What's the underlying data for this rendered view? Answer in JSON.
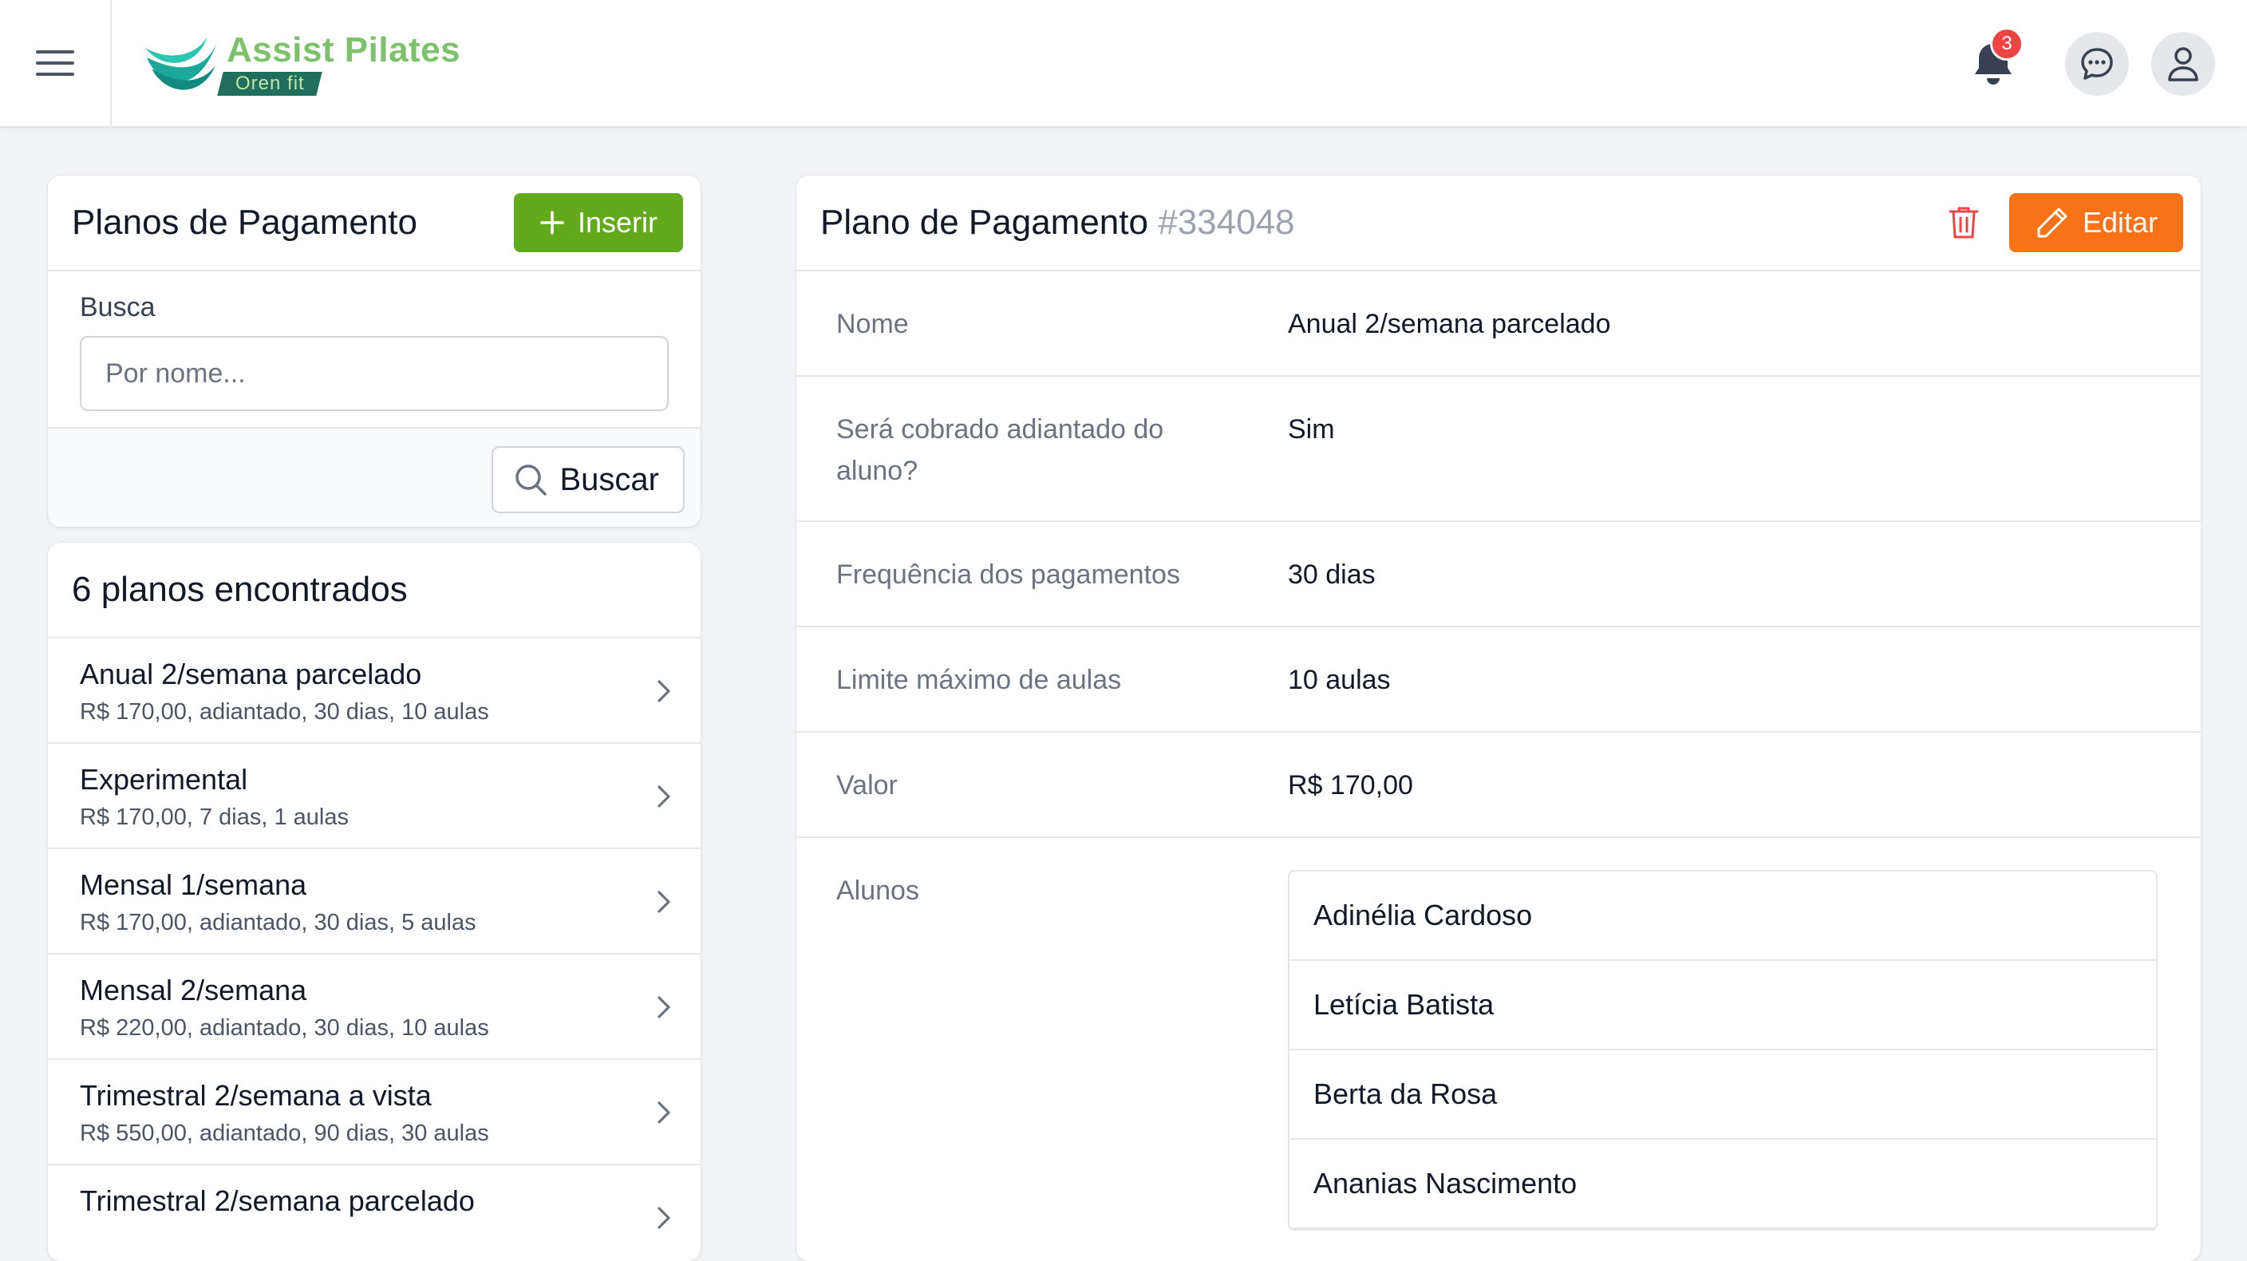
{
  "app": {
    "logo_title": "Assist Pilates",
    "logo_subtitle": "Oren fit",
    "notifications_count": "3"
  },
  "colors": {
    "primary_green": "#62a91c",
    "accent_orange": "#f97316",
    "danger_red": "#ef4444",
    "logo_green": "#7cc26a",
    "logo_dark": "#1f6f5c"
  },
  "icons": [
    "menu-icon",
    "bell-icon",
    "chat-icon",
    "user-icon",
    "plus-icon",
    "search-icon",
    "chevron-right-icon",
    "trash-icon",
    "pencil-icon"
  ],
  "plans_panel": {
    "title": "Planos de Pagamento",
    "insert_label": "Inserir",
    "search_label": "Busca",
    "search_placeholder": "Por nome...",
    "search_value": "",
    "search_button": "Buscar"
  },
  "results": {
    "title": "6 planos encontrados",
    "items": [
      {
        "title": "Anual 2/semana parcelado",
        "subtitle": "R$ 170,00, adiantado, 30 dias, 10 aulas"
      },
      {
        "title": "Experimental",
        "subtitle": "R$ 170,00, 7 dias, 1 aulas"
      },
      {
        "title": "Mensal 1/semana",
        "subtitle": "R$ 170,00, adiantado, 30 dias, 5 aulas"
      },
      {
        "title": "Mensal 2/semana",
        "subtitle": "R$ 220,00, adiantado, 30 dias, 10 aulas"
      },
      {
        "title": "Trimestral 2/semana a vista",
        "subtitle": "R$ 550,00, adiantado, 90 dias, 30 aulas"
      },
      {
        "title": "Trimestral 2/semana parcelado",
        "subtitle": ""
      }
    ]
  },
  "detail": {
    "title": "Plano de Pagamento",
    "id": "#334048",
    "edit_label": "Editar",
    "fields": [
      {
        "label": "Nome",
        "value": "Anual 2/semana parcelado"
      },
      {
        "label": "Será cobrado adiantado do aluno?",
        "value": "Sim"
      },
      {
        "label": "Frequência dos pagamentos",
        "value": "30 dias"
      },
      {
        "label": "Limite máximo de aulas",
        "value": "10 aulas"
      },
      {
        "label": "Valor",
        "value": "R$ 170,00"
      }
    ],
    "students_label": "Alunos",
    "students": [
      "Adinélia Cardoso",
      "Letícia Batista",
      "Berta da Rosa",
      "Ananias Nascimento"
    ]
  }
}
